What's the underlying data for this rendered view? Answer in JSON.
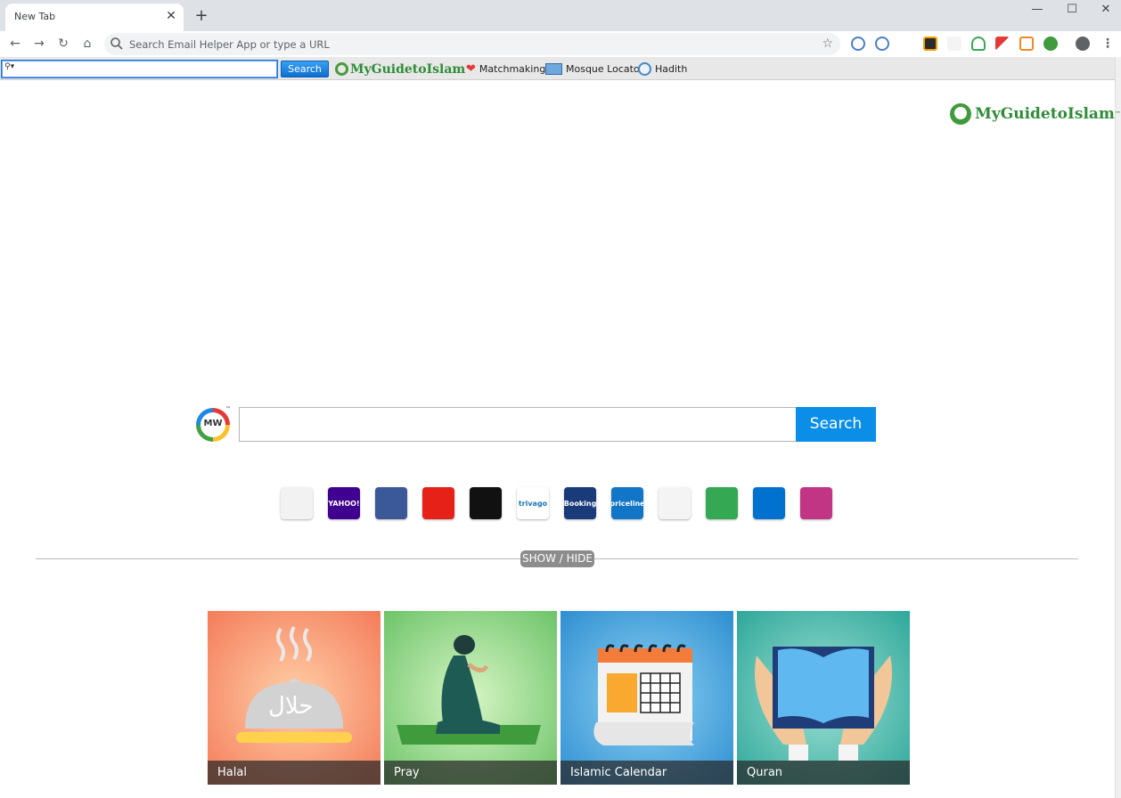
{
  "browser": {
    "tab_title": "New Tab",
    "omnibox_placeholder": "Search Email Helper App or type a URL"
  },
  "custom_bar": {
    "search_label": "Search",
    "logo_text": "MyGuidetoIslam",
    "logo_tm": "™",
    "links": [
      "Matchmaking",
      "Mosque Locator",
      "Hadith"
    ]
  },
  "page": {
    "brand_logo_text": "MyGuidetoIslam",
    "brand_logo_tm": "™",
    "mw_logo": "MW",
    "mw_tm": "™",
    "search_button": "Search",
    "show_hide": "SHOW / HIDE",
    "quick_links": [
      {
        "name": "gmail",
        "label": "",
        "color": "#f2f2f2"
      },
      {
        "name": "yahoo",
        "label": "YAHOO!",
        "color": "#400090"
      },
      {
        "name": "facebook",
        "label": "",
        "color": "#3b5998"
      },
      {
        "name": "youtube",
        "label": "",
        "color": "#e62117"
      },
      {
        "name": "amazon",
        "label": "",
        "color": "#111111"
      },
      {
        "name": "trivago",
        "label": "trivago",
        "color": "#ffffff"
      },
      {
        "name": "booking",
        "label": "Booking",
        "color": "#1a3b7a"
      },
      {
        "name": "priceline",
        "label": "priceline",
        "color": "#1176c7"
      },
      {
        "name": "macys",
        "label": "",
        "color": "#f4f4f4"
      },
      {
        "name": "tripadvisor",
        "label": "",
        "color": "#34a853"
      },
      {
        "name": "walmart",
        "label": "",
        "color": "#0071ce"
      },
      {
        "name": "instagram",
        "label": "",
        "color": "#c13584"
      }
    ],
    "tiles": [
      {
        "name": "halal",
        "label": "Halal",
        "overlay": "حلال"
      },
      {
        "name": "pray",
        "label": "Pray"
      },
      {
        "name": "islamic-calendar",
        "label": "Islamic Calendar"
      },
      {
        "name": "quran",
        "label": "Quran"
      }
    ]
  }
}
